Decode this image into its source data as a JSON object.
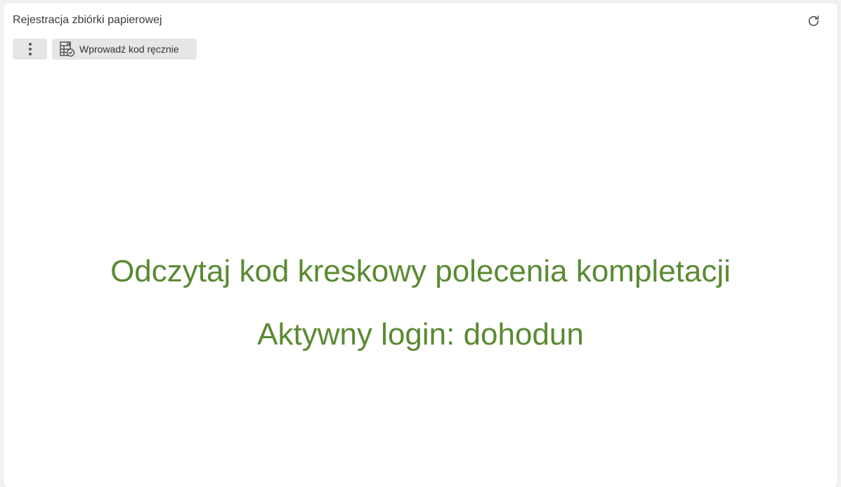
{
  "panel": {
    "title": "Rejestracja zbiórki papierowej",
    "refresh_icon": "refresh-icon"
  },
  "toolbar": {
    "more_icon": "more-vertical-icon",
    "manual_entry_label": "Wprowadź kod ręcznie",
    "manual_entry_icon": "table-check-icon"
  },
  "main": {
    "prompt_text": "Odczytaj kod kreskowy polecenia kompletacji",
    "active_login_text": "Aktywny login: dohodun"
  },
  "colors": {
    "message_green": "#5a8a32",
    "button_bg": "#e6e6e6"
  }
}
